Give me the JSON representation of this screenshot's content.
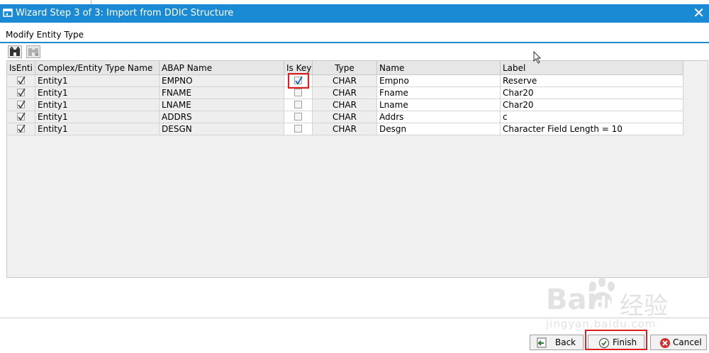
{
  "window": {
    "title": "Wizard Step 3 of 3: Import from DDIC Structure",
    "close": "✕"
  },
  "section": {
    "title": "Modify Entity Type"
  },
  "toolbar": {
    "icons": [
      "binoculars-icon",
      "binoculars-next-icon"
    ]
  },
  "table": {
    "headers": [
      "IsEnti",
      "Complex/Entity Type Name",
      "ABAP Name",
      "Is Key",
      "Type",
      "Name",
      "Label"
    ],
    "rows": [
      {
        "is_entity": true,
        "entity_type": "Entity1",
        "abap_name": "EMPNO",
        "is_key": true,
        "type": "CHAR",
        "name": "Empno",
        "label": "Reserve"
      },
      {
        "is_entity": true,
        "entity_type": "Entity1",
        "abap_name": "FNAME",
        "is_key": false,
        "type": "CHAR",
        "name": "Fname",
        "label": "Char20"
      },
      {
        "is_entity": true,
        "entity_type": "Entity1",
        "abap_name": "LNAME",
        "is_key": false,
        "type": "CHAR",
        "name": "Lname",
        "label": "Char20"
      },
      {
        "is_entity": true,
        "entity_type": "Entity1",
        "abap_name": "ADDRS",
        "is_key": false,
        "type": "CHAR",
        "name": "Addrs",
        "label": "c"
      },
      {
        "is_entity": true,
        "entity_type": "Entity1",
        "abap_name": "DESGN",
        "is_key": false,
        "type": "CHAR",
        "name": "Desgn",
        "label": "Character Field Length = 10"
      }
    ]
  },
  "buttons": {
    "back": "Back",
    "finish": "Finish",
    "cancel": "Cancel"
  },
  "watermark": {
    "brand": "Bai",
    "brand2": "du",
    "cn": "经验",
    "url": "jingyan.baidu.com"
  },
  "colors": {
    "titlebar": "#1a8ad4",
    "highlight": "#e02020"
  }
}
